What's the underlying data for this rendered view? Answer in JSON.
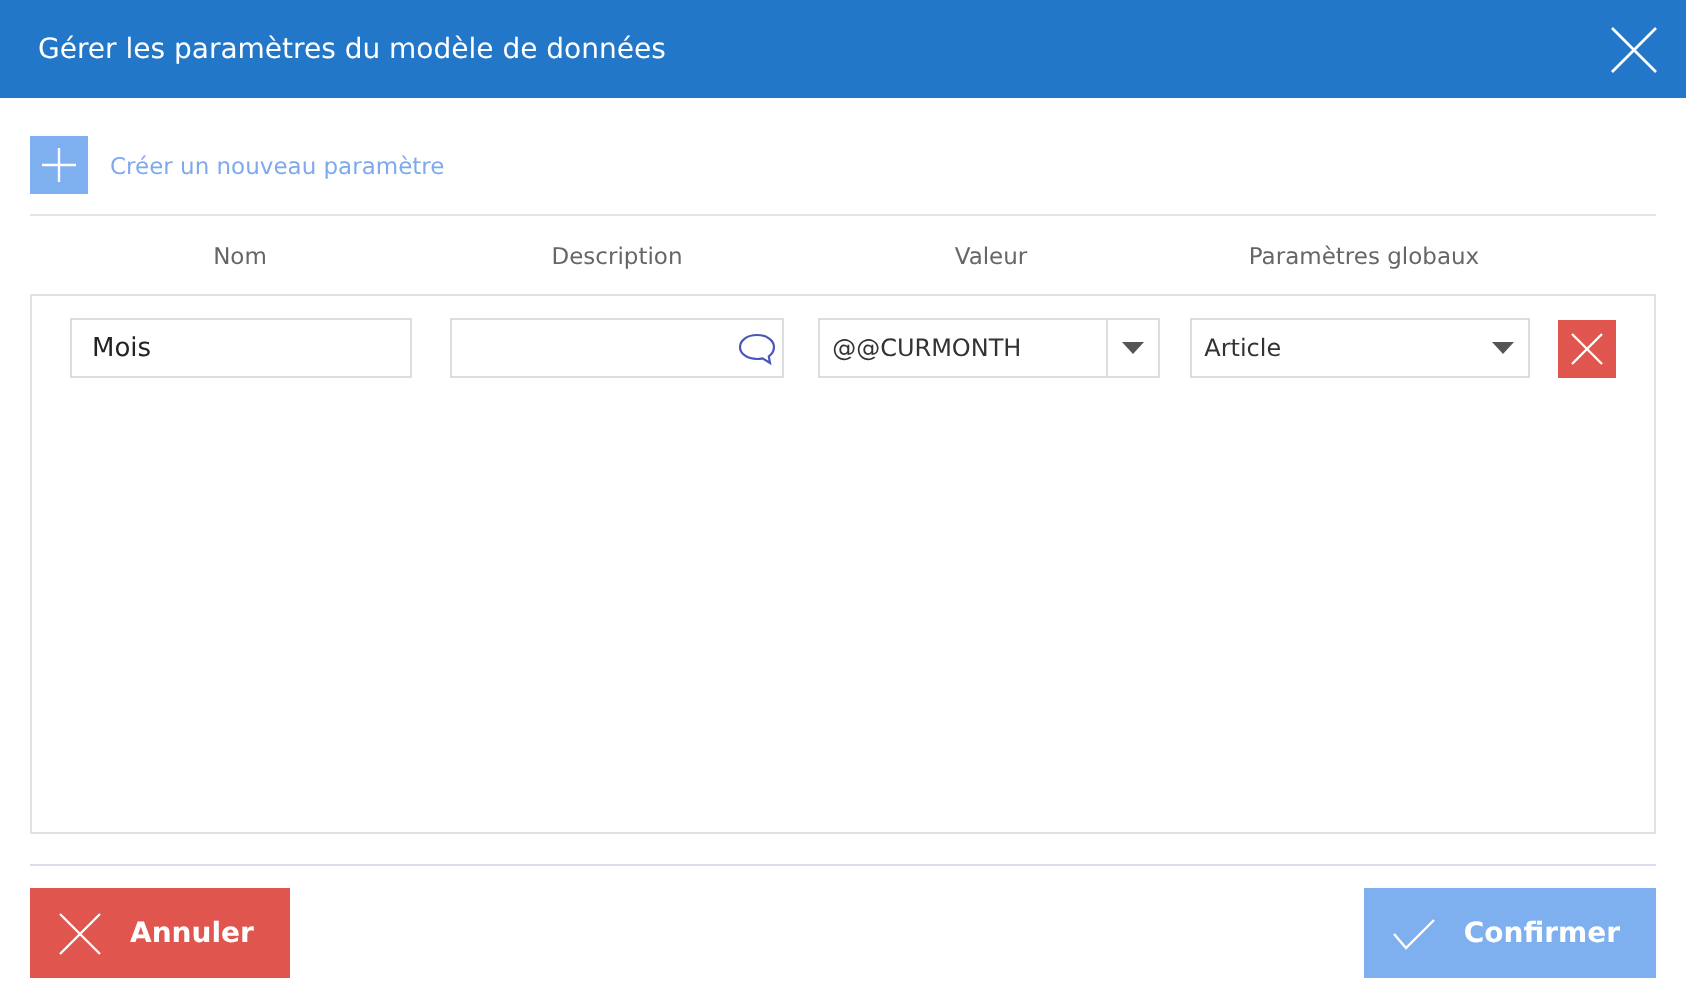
{
  "window": {
    "title": "Gérer les paramètres du modèle de données"
  },
  "add_parameter": {
    "label": "Créer un nouveau paramètre"
  },
  "table": {
    "columns": [
      "Nom",
      "Description",
      "Valeur",
      "Paramètres globaux"
    ],
    "rows": [
      {
        "name": "Mois",
        "description": "",
        "value": "@@CURMONTH",
        "global": "Article"
      }
    ]
  },
  "buttons": [
    {
      "kind": "cancel",
      "label": "Annuler",
      "disabled": false
    },
    {
      "kind": "confirm",
      "label": "Confirmer",
      "disabled": true
    }
  ]
}
